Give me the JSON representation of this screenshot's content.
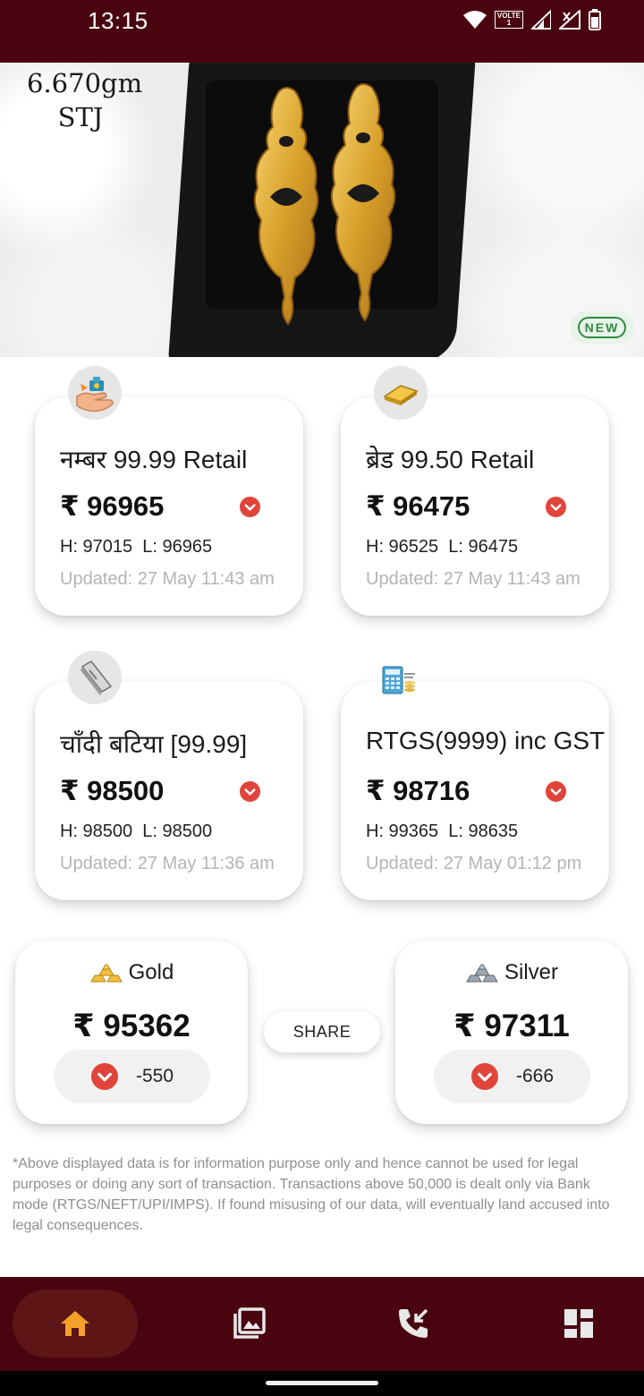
{
  "status_bar": {
    "time": "13:15",
    "volte_label": "VOLTE",
    "sim_label": "1",
    "icons": [
      "wifi-icon",
      "volte-icon",
      "signal-icon",
      "signal-no-data-icon",
      "battery-icon"
    ]
  },
  "banner": {
    "weight_line1": "6.670gm",
    "weight_line2": "STJ",
    "badge": "NEW"
  },
  "rates": [
    {
      "icon": "hand-gold-icon",
      "title": "नम्बर 99.99 Retail",
      "price": "₹ 96965",
      "hl": "H: 97015  L: 96965",
      "updated": "Updated: 27 May 11:43 am",
      "trend": "down"
    },
    {
      "icon": "gold-bar-icon",
      "title": "ब्रेड 99.50 Retail",
      "price": "₹ 96475",
      "hl": "H: 96525  L: 96475",
      "updated": "Updated: 27 May 11:43 am",
      "trend": "down"
    },
    {
      "icon": "silver-bar-icon",
      "title": "चाँदी बटिया [99.99]",
      "price": "₹ 98500",
      "hl": "H: 98500  L: 98500",
      "updated": "Updated: 27 May 11:36 am",
      "trend": "down"
    },
    {
      "icon": "calculator-icon",
      "title": "RTGS(9999) inc GST",
      "price": "₹ 98716",
      "hl": "H: 99365  L: 98635",
      "updated": "Updated: 27 May 01:12 pm",
      "trend": "down"
    }
  ],
  "summary": {
    "gold": {
      "icon": "gold-stack-icon",
      "label": "Gold",
      "price": "₹ 95362",
      "change": "-550"
    },
    "silver": {
      "icon": "silver-stack-icon",
      "label": "Silver",
      "price": "₹ 97311",
      "change": "-666"
    },
    "share_label": "SHARE"
  },
  "disclaimer": "*Above displayed data is for information purpose only and hence cannot be used for legal purposes or doing any sort of transaction. Transactions above 50,000 is dealt only via Bank mode (RTGS/NEFT/UPI/IMPS). If found misusing of our data, will eventually land accused into legal consequences.",
  "bottom_nav": [
    {
      "icon": "home-icon",
      "active": true
    },
    {
      "icon": "gallery-icon",
      "active": false
    },
    {
      "icon": "phone-call-icon",
      "active": false
    },
    {
      "icon": "dashboard-icon",
      "active": false
    }
  ],
  "colors": {
    "brand": "#4a0410",
    "nav_active": "#5e1515",
    "home_accent": "#f4a12a",
    "down": "#e0443a",
    "new_badge": "#2e8b3e"
  }
}
